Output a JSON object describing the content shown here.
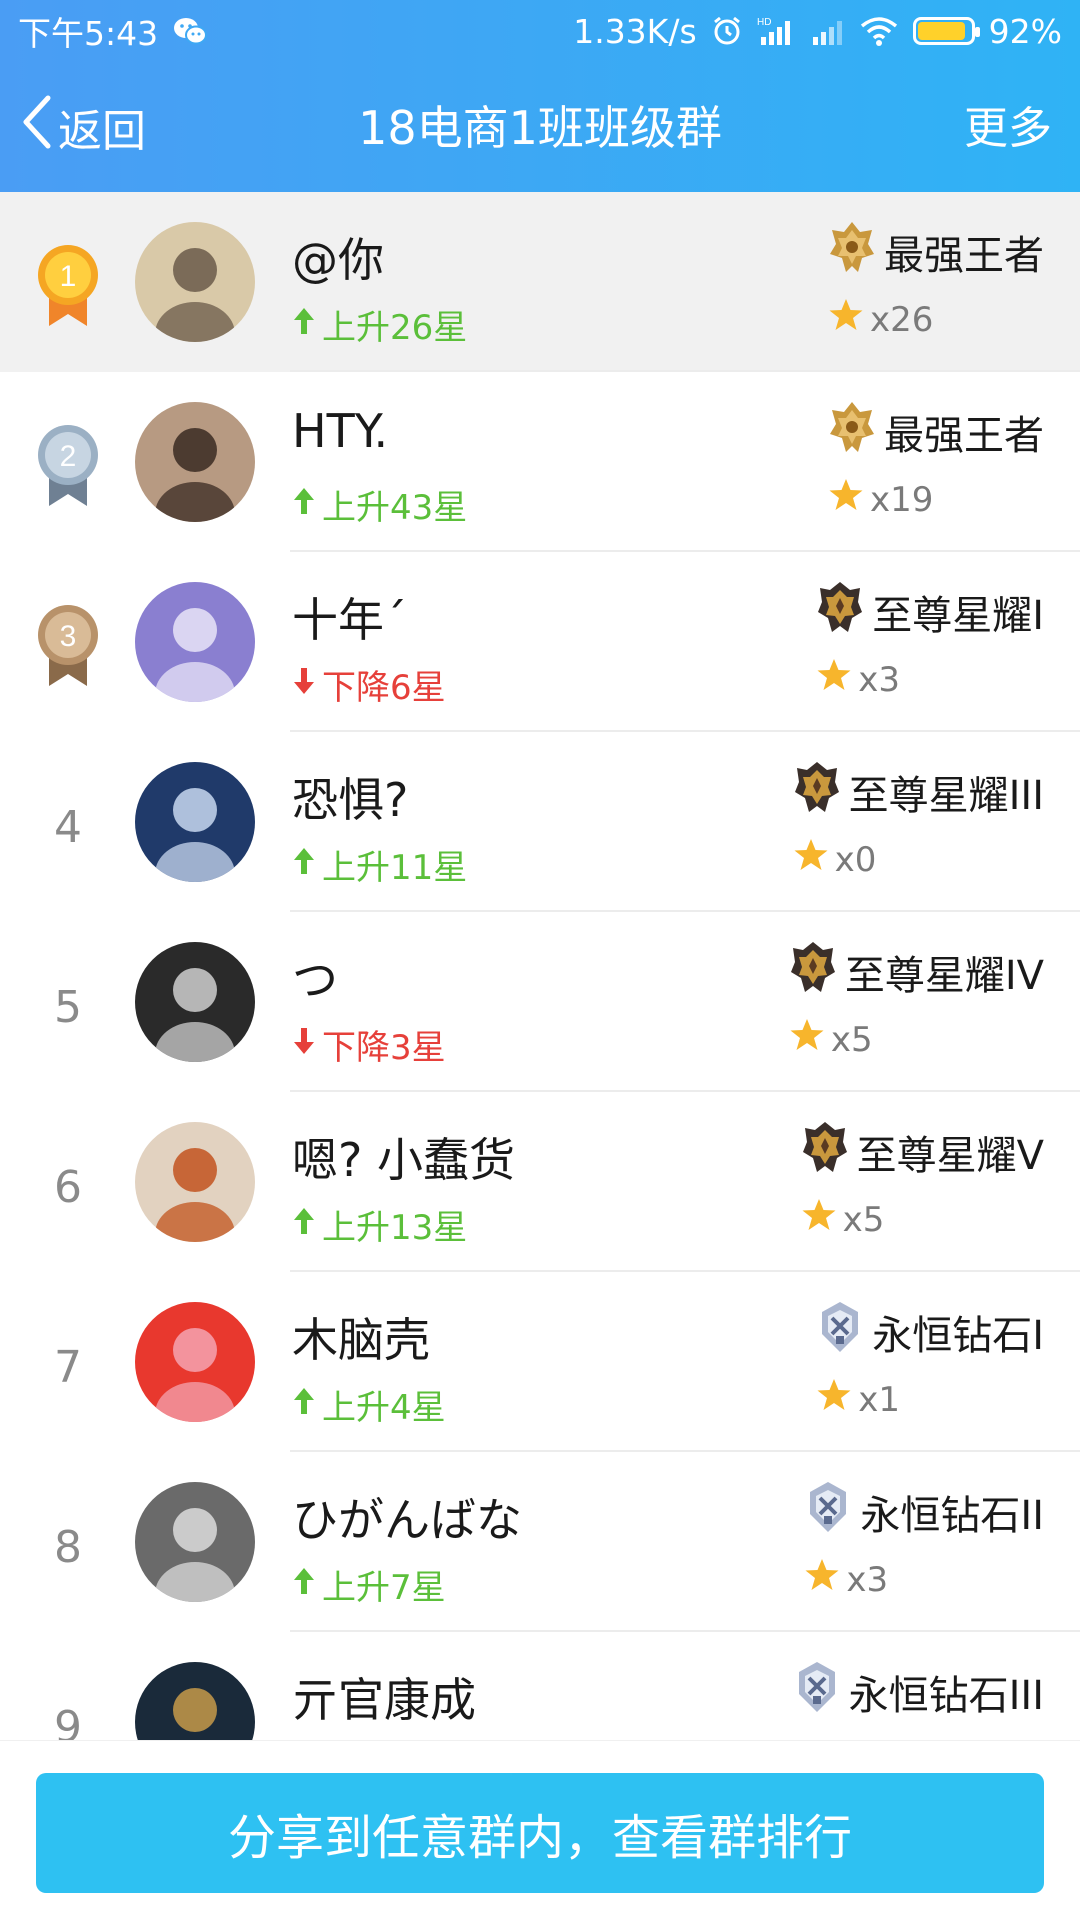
{
  "status_bar": {
    "time": "下午5:43",
    "net_speed": "1.33K/s",
    "battery_percent": "92%",
    "battery_level": 0.92,
    "icons": [
      "wechat-icon",
      "alarm-icon",
      "hd-signal-icon",
      "signal-icon",
      "wifi-icon",
      "battery-icon"
    ]
  },
  "nav": {
    "back_label": "返回",
    "title": "18电商1班班级群",
    "more_label": "更多"
  },
  "ranking": [
    {
      "rank": "1",
      "medal": "gold",
      "name": "@你",
      "trend_dir": "up",
      "trend": "上升26星",
      "tier_icon": "king-badge-icon",
      "tier": "最强王者",
      "stars": "x26",
      "highlight": true
    },
    {
      "rank": "2",
      "medal": "silver",
      "name": "HTY.",
      "trend_dir": "up",
      "trend": "上升43星",
      "tier_icon": "king-badge-icon",
      "tier": "最强王者",
      "stars": "x19",
      "highlight": false
    },
    {
      "rank": "3",
      "medal": "bronze",
      "name": "十年´",
      "trend_dir": "down",
      "trend": "下降6星",
      "tier_icon": "glory-badge-icon",
      "tier": "至尊星耀I",
      "stars": "x3",
      "highlight": false
    },
    {
      "rank": "4",
      "medal": "none",
      "name": "恐惧?",
      "trend_dir": "up",
      "trend": "上升11星",
      "tier_icon": "glory-badge-icon",
      "tier": "至尊星耀III",
      "stars": "x0",
      "highlight": false
    },
    {
      "rank": "5",
      "medal": "none",
      "name": "つ",
      "trend_dir": "down",
      "trend": "下降3星",
      "tier_icon": "glory-badge-icon",
      "tier": "至尊星耀IV",
      "stars": "x5",
      "highlight": false
    },
    {
      "rank": "6",
      "medal": "none",
      "name": "嗯? 小蠢货",
      "trend_dir": "up",
      "trend": "上升13星",
      "tier_icon": "glory-badge-icon",
      "tier": "至尊星耀V",
      "stars": "x5",
      "highlight": false
    },
    {
      "rank": "7",
      "medal": "none",
      "name": "木脑壳",
      "trend_dir": "up",
      "trend": "上升4星",
      "tier_icon": "diamond-badge-icon",
      "tier": "永恒钻石I",
      "stars": "x1",
      "highlight": false
    },
    {
      "rank": "8",
      "medal": "none",
      "name": "ひがんばな",
      "trend_dir": "up",
      "trend": "上升7星",
      "tier_icon": "diamond-badge-icon",
      "tier": "永恒钻石II",
      "stars": "x3",
      "highlight": false
    },
    {
      "rank": "9",
      "medal": "none",
      "name": "亓官康成",
      "trend_dir": "up",
      "trend": "",
      "tier_icon": "diamond-badge-icon",
      "tier": "永恒钻石III",
      "stars": "",
      "highlight": false
    }
  ],
  "share_button_label": "分享到任意群内，查看群排行",
  "colors": {
    "header_start": "#4a9df4",
    "header_end": "#2fb3f5",
    "trend_up": "#5bbf3a",
    "trend_down": "#e6403a",
    "share_button": "#2ec1f2",
    "gold": "#f5a623",
    "silver": "#8fa3b8",
    "bronze": "#b8926a"
  }
}
